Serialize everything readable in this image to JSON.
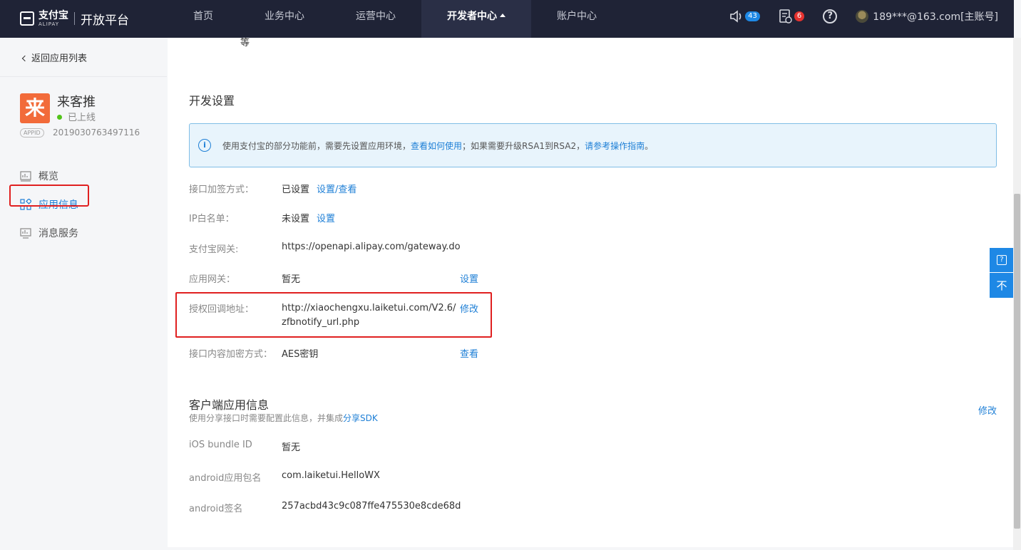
{
  "header": {
    "logo_cn": "支付宝",
    "logo_en": "ALIPAY",
    "platform": "开放平台",
    "nav": [
      {
        "label": "首页"
      },
      {
        "label": "业务中心"
      },
      {
        "label": "运营中心"
      },
      {
        "label": "开发者中心"
      },
      {
        "label": "账户中心"
      }
    ],
    "notifications_count": "43",
    "messages_count": "6",
    "help_glyph": "?",
    "user": "189***@163.com[主账号]"
  },
  "sidebar": {
    "back_label": "返回应用列表",
    "app_logo_char": "来",
    "app_name": "来客推",
    "app_status": "已上线",
    "appid_tag": "APPID",
    "appid": "2019030763497116",
    "menu": [
      {
        "label": "概览"
      },
      {
        "label": "应用信息"
      },
      {
        "label": "消息服务"
      }
    ]
  },
  "main": {
    "stray_char": "等",
    "dev_settings_title": "开发设置",
    "info": {
      "text1": "使用支付宝的部分功能前，需要先设置应用环境，",
      "link1": "查看如何使用",
      "text2": "；如果需要升级RSA1到RSA2，",
      "link2": "请参考操作指南",
      "text3": "。"
    },
    "rows": {
      "sign_label": "接口加签方式：",
      "sign_value": "已设置",
      "sign_action": "设置/查看",
      "ip_label": "IP白名单：",
      "ip_value": "未设置",
      "ip_action": "设置",
      "gateway_label": "支付宝网关:",
      "gateway_value": "https://openapi.alipay.com/gateway.do",
      "appgw_label": "应用网关：",
      "appgw_value": "暂无",
      "appgw_action": "设置",
      "callback_label": "授权回调地址：",
      "callback_value": "http://xiaochengxu.laiketui.com/V2.6/zfbnotify_url.php",
      "callback_action": "修改",
      "encrypt_label": "接口内容加密方式：",
      "encrypt_value": "AES密钥",
      "encrypt_action": "查看"
    },
    "client": {
      "title": "客户端应用信息",
      "desc_text": "使用分享接口时需要配置此信息，并集成",
      "desc_link": "分享SDK",
      "edit": "修改",
      "ios_label": "iOS bundle ID",
      "ios_value": "暂无",
      "android_pkg_label": "android应用包名",
      "android_pkg_value": "com.laiketui.HelloWX",
      "android_sig_label": "android签名",
      "android_sig_value": "257acbd43c9c087ffe475530e8cde68d"
    }
  },
  "float": {
    "help_glyph": "?",
    "top_glyph": "不"
  }
}
